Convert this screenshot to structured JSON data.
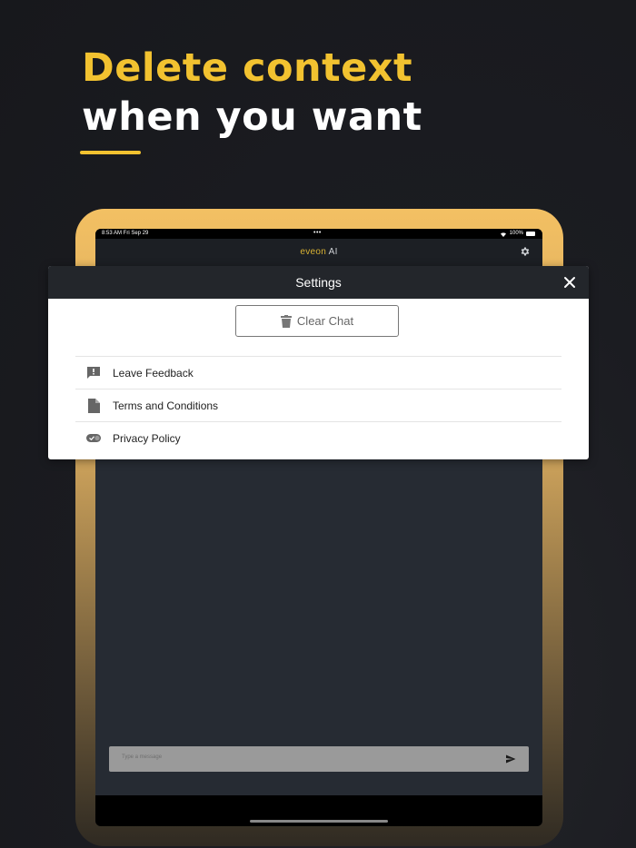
{
  "hero": {
    "line1": "Delete context",
    "line2": "when you want",
    "accent_color": "#f2c230"
  },
  "status_bar": {
    "time": "8:53 AM  Fri Sep 29",
    "dots": "•••",
    "battery": "100%"
  },
  "app": {
    "brand_part1": "eveon",
    "brand_part2": " AI",
    "settings_icon": "gear-icon"
  },
  "settings_modal": {
    "title": "Settings",
    "close_icon": "close-icon",
    "clear_chat_label": "Clear Chat",
    "clear_chat_icon": "trash-icon",
    "menu": [
      {
        "label": "Leave Feedback",
        "icon": "feedback-icon"
      },
      {
        "label": "Terms and Conditions",
        "icon": "document-icon"
      },
      {
        "label": "Privacy Policy",
        "icon": "toggle-icon"
      }
    ]
  },
  "composer": {
    "placeholder": "Type a message",
    "send_icon": "send-icon"
  }
}
